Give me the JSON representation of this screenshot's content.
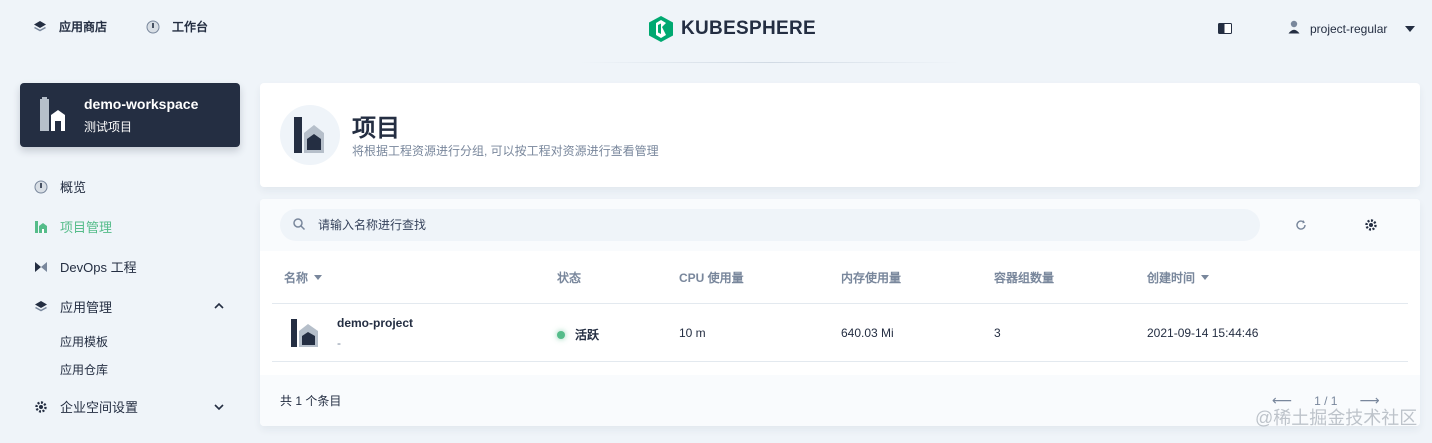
{
  "topbar": {
    "app_store_label": "应用商店",
    "workbench_label": "工作台",
    "brand_name": "KUBESPHERE",
    "username": "project-regular"
  },
  "sidebar": {
    "workspace_name": "demo-workspace",
    "workspace_subtitle": "测试项目",
    "items": [
      {
        "label": "概览"
      },
      {
        "label": "项目管理"
      },
      {
        "label": "DevOps 工程"
      },
      {
        "label": "应用管理"
      },
      {
        "label": "应用模板"
      },
      {
        "label": "应用仓库"
      },
      {
        "label": "企业空间设置"
      }
    ]
  },
  "header": {
    "title": "项目",
    "description": "将根据工程资源进行分组, 可以按工程对资源进行查看管理"
  },
  "search": {
    "placeholder": "请输入名称进行查找"
  },
  "table": {
    "columns": [
      "名称",
      "状态",
      "CPU 使用量",
      "内存使用量",
      "容器组数量",
      "创建时间"
    ],
    "rows": [
      {
        "name": "demo-project",
        "description": "-",
        "status": "活跃",
        "cpu": "10 m",
        "memory": "640.03 Mi",
        "pods": "3",
        "created": "2021-09-14 15:44:46"
      }
    ]
  },
  "footer": {
    "total": "共 1 个条目",
    "page_indicator": "1 / 1"
  },
  "watermark": "@稀土掘金技术社区",
  "colors": {
    "accent": "#55bc8a",
    "dark": "#242e42",
    "muted": "#79879c",
    "background": "#eff4f9"
  }
}
